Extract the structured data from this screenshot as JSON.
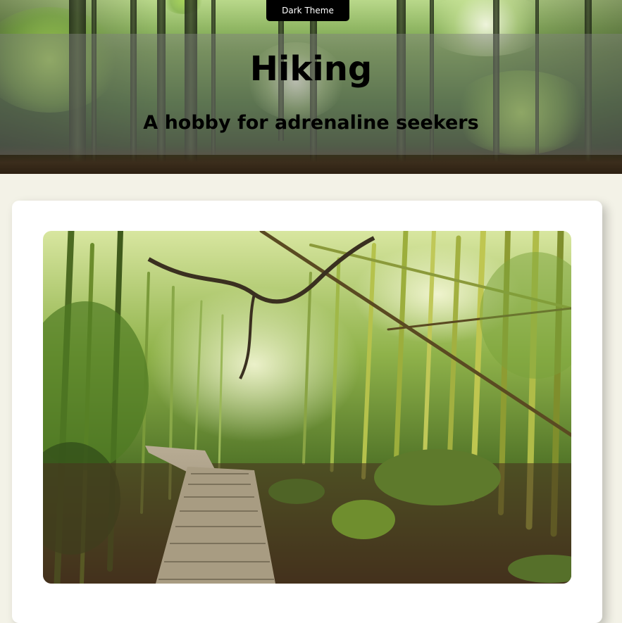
{
  "header": {
    "theme_button_label": "Dark Theme",
    "title": "Hiking",
    "subtitle": "A hobby for adrenaline seekers"
  },
  "colors": {
    "page_background": "#f3f2e7",
    "card_background": "#ffffff",
    "button_background": "#000000",
    "button_text": "#ffffff",
    "banner_overlay": "rgba(128,128,128,0.45)"
  },
  "images": {
    "hero_background": "forest-photo",
    "card_photo": "bamboo-forest-boardwalk-photo"
  }
}
